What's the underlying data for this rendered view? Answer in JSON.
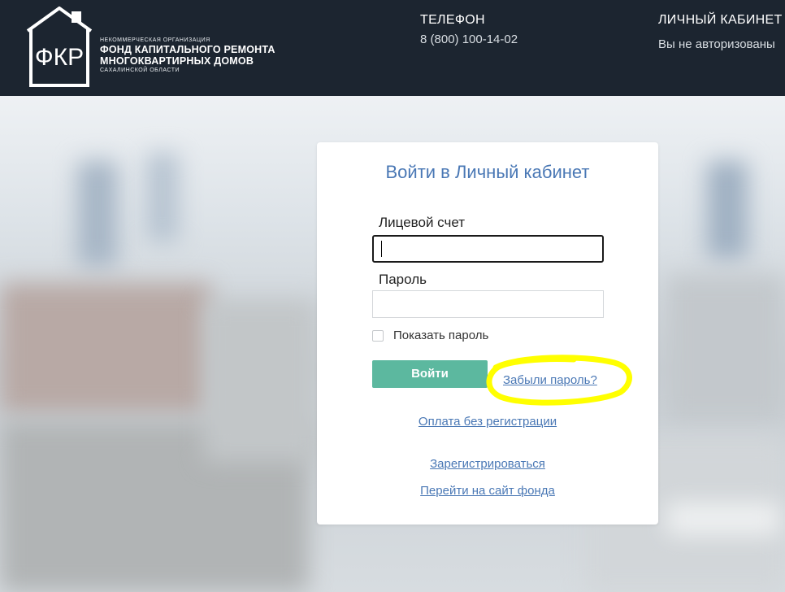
{
  "header": {
    "logo": {
      "monogram": "ФКР",
      "line1": "НЕКОММЕРЧЕСКАЯ ОРГАНИЗАЦИЯ",
      "line2": "ФОНД КАПИТАЛЬНОГО РЕМОНТА",
      "line3": "МНОГОКВАРТИРНЫХ ДОМОВ",
      "line4": "САХАЛИНСКОЙ ОБЛАСТИ"
    },
    "phone_label": "ТЕЛЕФОН",
    "phone_number": "8 (800) 100-14-02",
    "cabinet_label": "ЛИЧНЫЙ КАБИНЕТ",
    "cabinet_status": "Вы не авторизованы"
  },
  "login": {
    "title": "Войти в Личный кабинет",
    "account_label": "Лицевой счет",
    "account_value": "",
    "password_label": "Пароль",
    "password_value": "",
    "show_password_label": "Показать пароль",
    "login_button": "Войти",
    "forgot_link": "Забыли пароль?",
    "pay_link": "Оплата без регистрации",
    "register_link": "Зарегистрироваться",
    "site_link": "Перейти на сайт фонда"
  },
  "colors": {
    "header_bg": "#1c2530",
    "accent_blue": "#4a78b5",
    "button_green": "#5cb89f",
    "highlight": "#ffff00"
  }
}
